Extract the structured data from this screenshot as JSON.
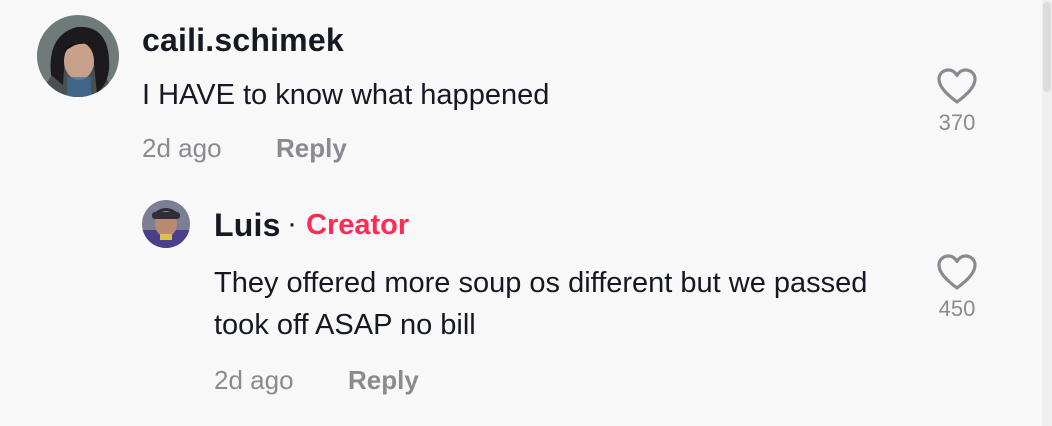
{
  "comment": {
    "username": "caili.schimek",
    "text": "I HAVE to know what happened",
    "time": "2d ago",
    "reply_label": "Reply",
    "likes": "370"
  },
  "reply": {
    "username": "Luis",
    "separator": "·",
    "badge": "Creator",
    "text": "They offered more soup os different but we passed took off ASAP no bill",
    "time": "2d ago",
    "reply_label": "Reply",
    "likes": "450"
  },
  "colors": {
    "background": "#f8f8f8",
    "text": "#161823",
    "muted": "#8a8b91",
    "creator_badge": "#fe2c55"
  },
  "icons": {
    "like": "heart-outline-icon",
    "avatar_main": "user-avatar",
    "avatar_reply": "creator-avatar"
  }
}
